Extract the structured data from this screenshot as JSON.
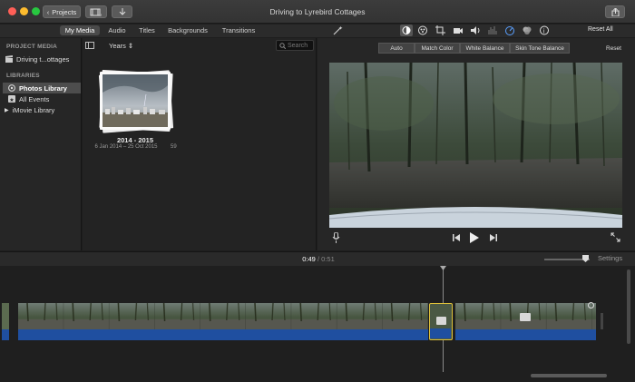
{
  "window": {
    "title": "Driving to Lyrebird Cottages",
    "back_label": "Projects",
    "buttons": {
      "media_import_icon": "film-icon",
      "import_icon": "download-icon",
      "share_icon": "share-icon"
    }
  },
  "topbar": {
    "tabs": [
      {
        "label": "My Media",
        "active": true
      },
      {
        "label": "Audio",
        "active": false
      },
      {
        "label": "Titles",
        "active": false
      },
      {
        "label": "Backgrounds",
        "active": false
      },
      {
        "label": "Transitions",
        "active": false
      }
    ],
    "reset_all_label": "Reset All"
  },
  "sidebar": {
    "project_media_header": "PROJECT MEDIA",
    "project_item": "Driving t...ottages",
    "libraries_header": "LIBRARIES",
    "items": [
      {
        "label": "Photos Library",
        "selected": true
      },
      {
        "label": "All Events",
        "selected": false
      },
      {
        "label": "iMovie Library",
        "selected": false
      }
    ]
  },
  "browser": {
    "group_by": "Years",
    "search_placeholder": "Search",
    "event": {
      "title": "2014 - 2015",
      "date_range": "6 Jan 2014 – 25 Oct 2015",
      "count": "59"
    }
  },
  "adjust": {
    "buttons": [
      "Auto",
      "Match Color",
      "White Balance",
      "Skin Tone Balance"
    ],
    "reset_label": "Reset"
  },
  "timeline": {
    "current_time": "0:49",
    "separator": "/",
    "total_time": "0:51",
    "settings_label": "Settings"
  },
  "colors": {
    "accent_selected": "#e0c23a",
    "audio_track": "#1f4fa0",
    "background": "#1e1e1e"
  }
}
